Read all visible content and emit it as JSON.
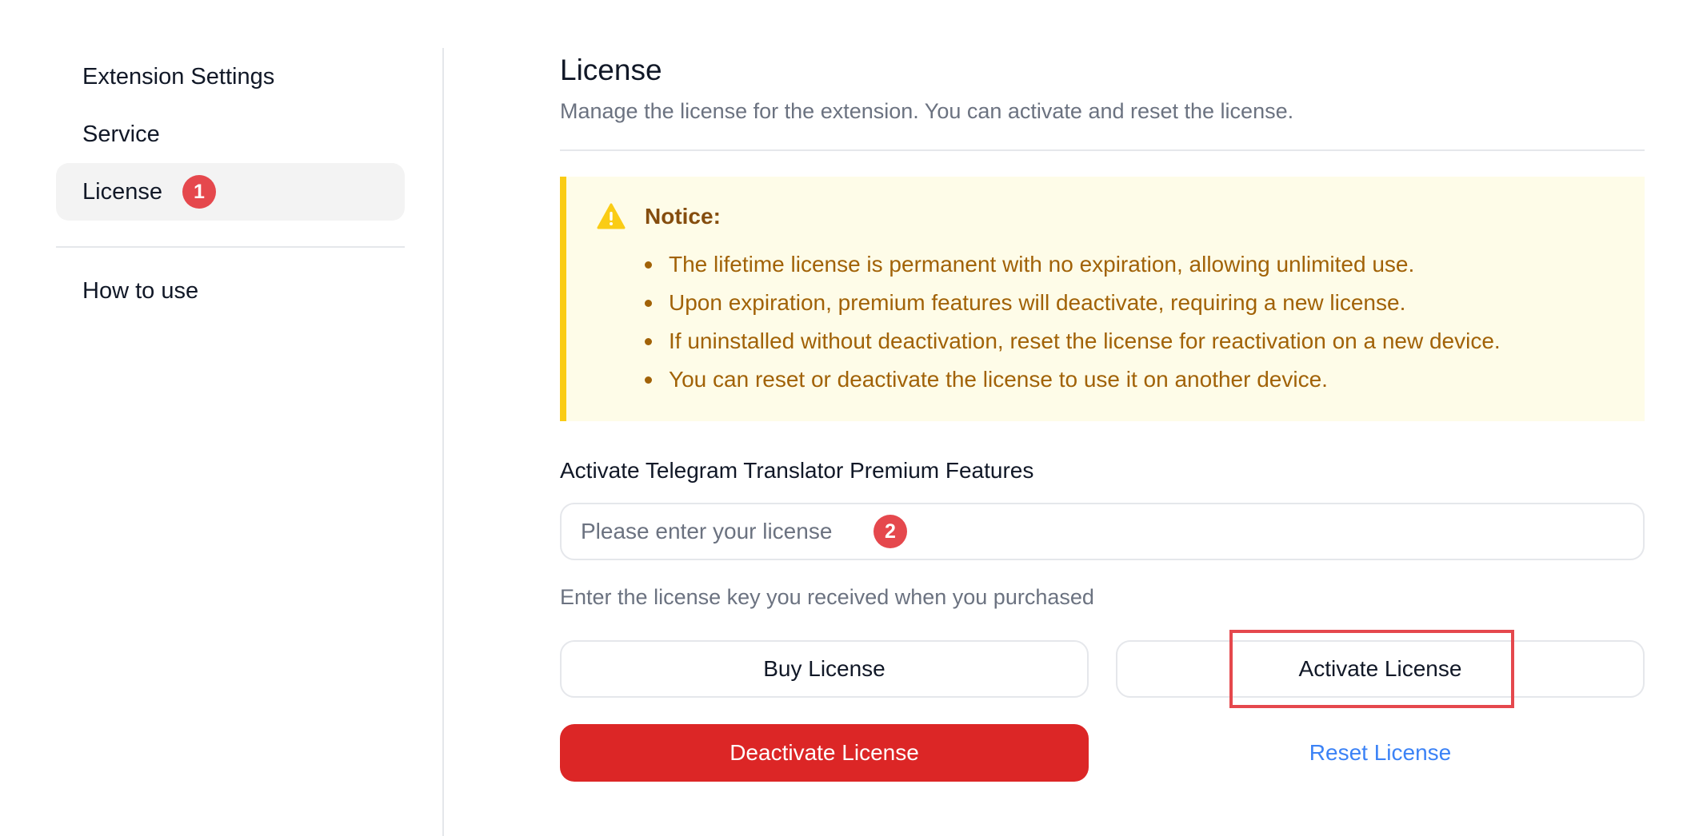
{
  "sidebar": {
    "items": [
      {
        "label": "Extension Settings"
      },
      {
        "label": "Service"
      },
      {
        "label": "License",
        "badge": "1",
        "active": true
      }
    ],
    "secondary_items": [
      {
        "label": "How to use"
      }
    ]
  },
  "header": {
    "title": "License",
    "subtitle": "Manage the license for the extension. You can activate and reset the license."
  },
  "notice": {
    "icon": "warning-icon",
    "title": "Notice:",
    "items": [
      "The lifetime license is permanent with no expiration, allowing unlimited use.",
      "Upon expiration, premium features will deactivate, requiring a new license.",
      "If uninstalled without deactivation, reset the license for reactivation on a new device.",
      "You can reset or deactivate the license to use it on another device."
    ]
  },
  "activation": {
    "label": "Activate Telegram Translator Premium Features",
    "input_placeholder": "Please enter your license",
    "input_value": "",
    "input_badge": "2",
    "help_text": "Enter the license key you received when you purchased"
  },
  "buttons": {
    "buy": "Buy License",
    "activate": "Activate License",
    "deactivate": "Deactivate License",
    "reset": "Reset License"
  },
  "colors": {
    "badge": "#e5484d",
    "danger": "#dc2626",
    "link": "#3b82f6",
    "notice_bg": "#fefce8",
    "notice_border": "#facc15",
    "notice_text": "#a16207"
  }
}
